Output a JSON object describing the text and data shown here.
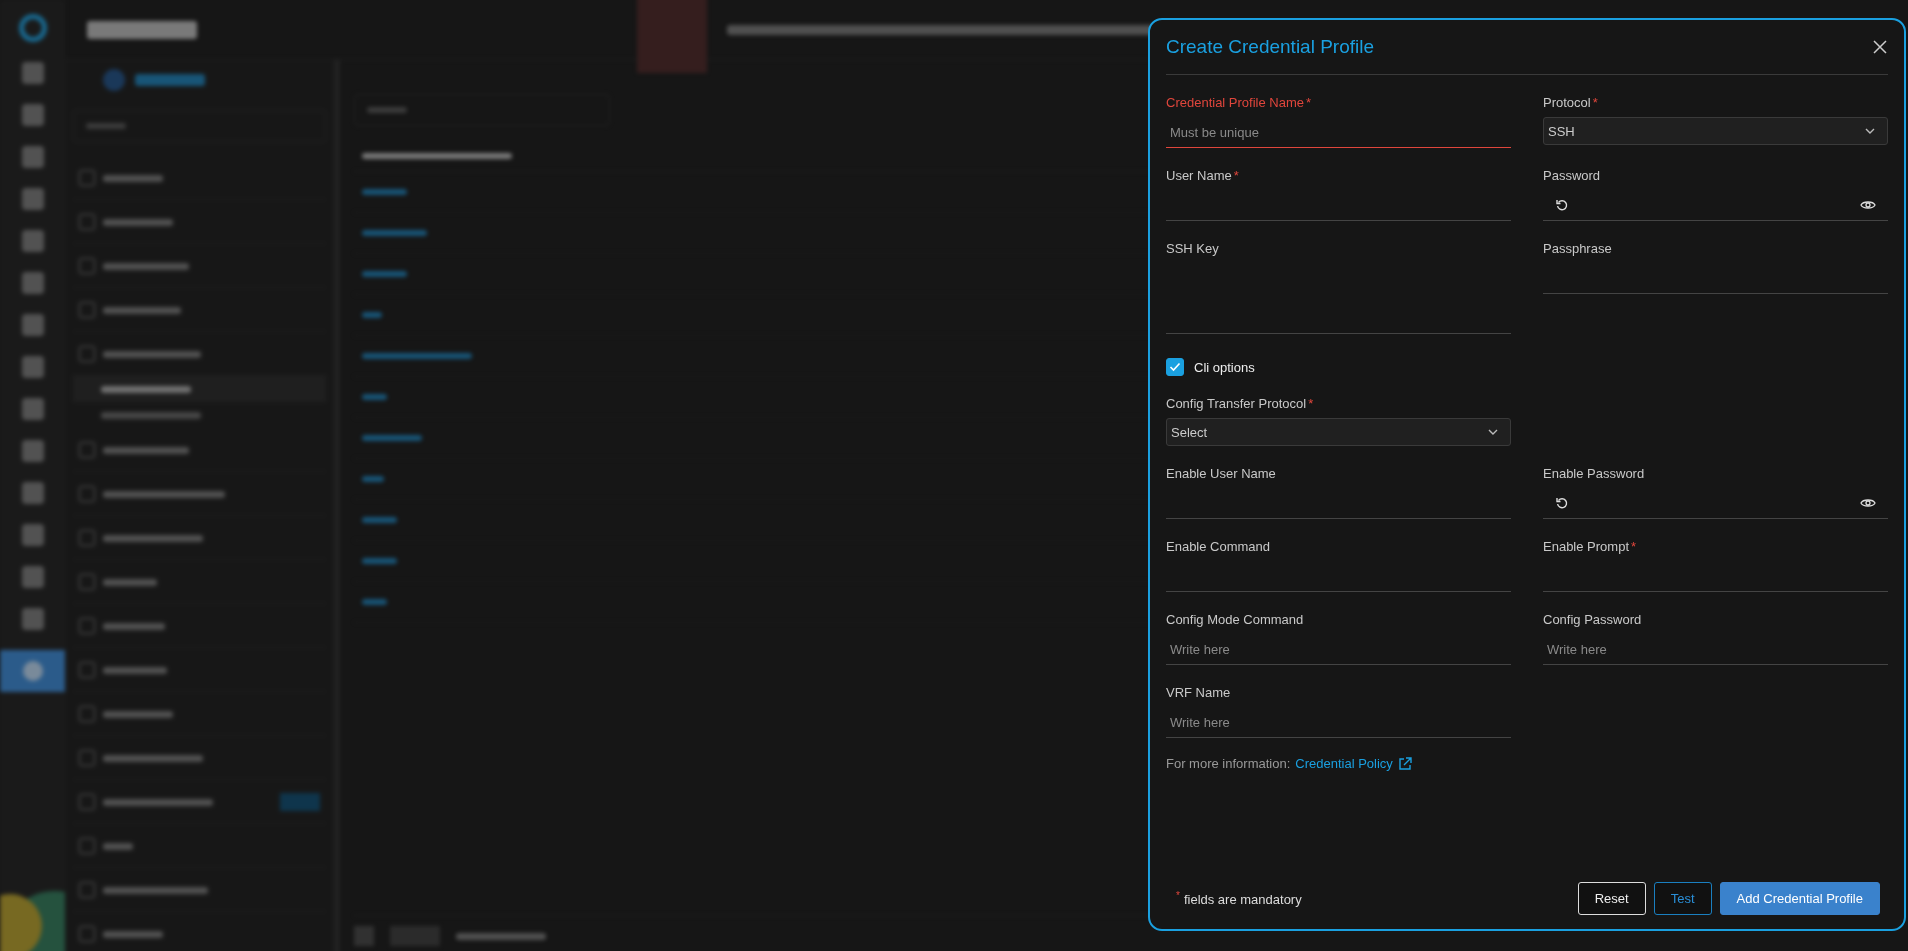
{
  "dialog": {
    "title": "Create Credential Profile",
    "rows": [
      {
        "left": {
          "kind": "text",
          "label": "Credential Profile Name",
          "marker": "*",
          "placeholder": "Must be unique",
          "error": true
        },
        "right": {
          "kind": "select",
          "label": "Protocol",
          "marker": "*",
          "value": "SSH"
        }
      },
      {
        "left": {
          "kind": "text",
          "label": "User Name",
          "marker": "*",
          "error": false
        },
        "right": {
          "kind": "password",
          "label": "Password"
        }
      },
      {
        "left": {
          "kind": "textarea",
          "label": "SSH Key"
        },
        "right": {
          "kind": "text",
          "label": "Passphrase",
          "error": false
        }
      },
      {
        "left": {
          "kind": "checkbox",
          "label": "Cli options",
          "checked": true
        }
      },
      {
        "left": {
          "kind": "select",
          "label": "Config Transfer Protocol",
          "marker": "*",
          "value": "Select"
        }
      },
      {
        "left": {
          "kind": "text",
          "label": "Enable User Name",
          "error": false
        },
        "right": {
          "kind": "password",
          "label": "Enable Password"
        }
      },
      {
        "left": {
          "kind": "text",
          "label": "Enable Command",
          "error": false
        },
        "right": {
          "kind": "text",
          "label": "Enable Prompt",
          "marker": "*",
          "error": false
        }
      },
      {
        "left": {
          "kind": "text",
          "label": "Config Mode Command",
          "placeholder": "Write here",
          "error": false
        },
        "right": {
          "kind": "text",
          "label": "Config Password",
          "placeholder": "Write here",
          "error": false
        }
      },
      {
        "left": {
          "kind": "text",
          "label": "VRF Name",
          "placeholder": "Write here",
          "error": false
        }
      }
    ],
    "info": {
      "text": "For more information:",
      "link": "Credential Policy"
    },
    "mandatory_note": {
      "marker": "*",
      "text": "fields are mandatory"
    },
    "buttons": [
      {
        "label": "Reset",
        "kind": "outline"
      },
      {
        "label": "Test",
        "kind": "secondary"
      },
      {
        "label": "Add Credential Profile",
        "kind": "primary"
      }
    ]
  }
}
